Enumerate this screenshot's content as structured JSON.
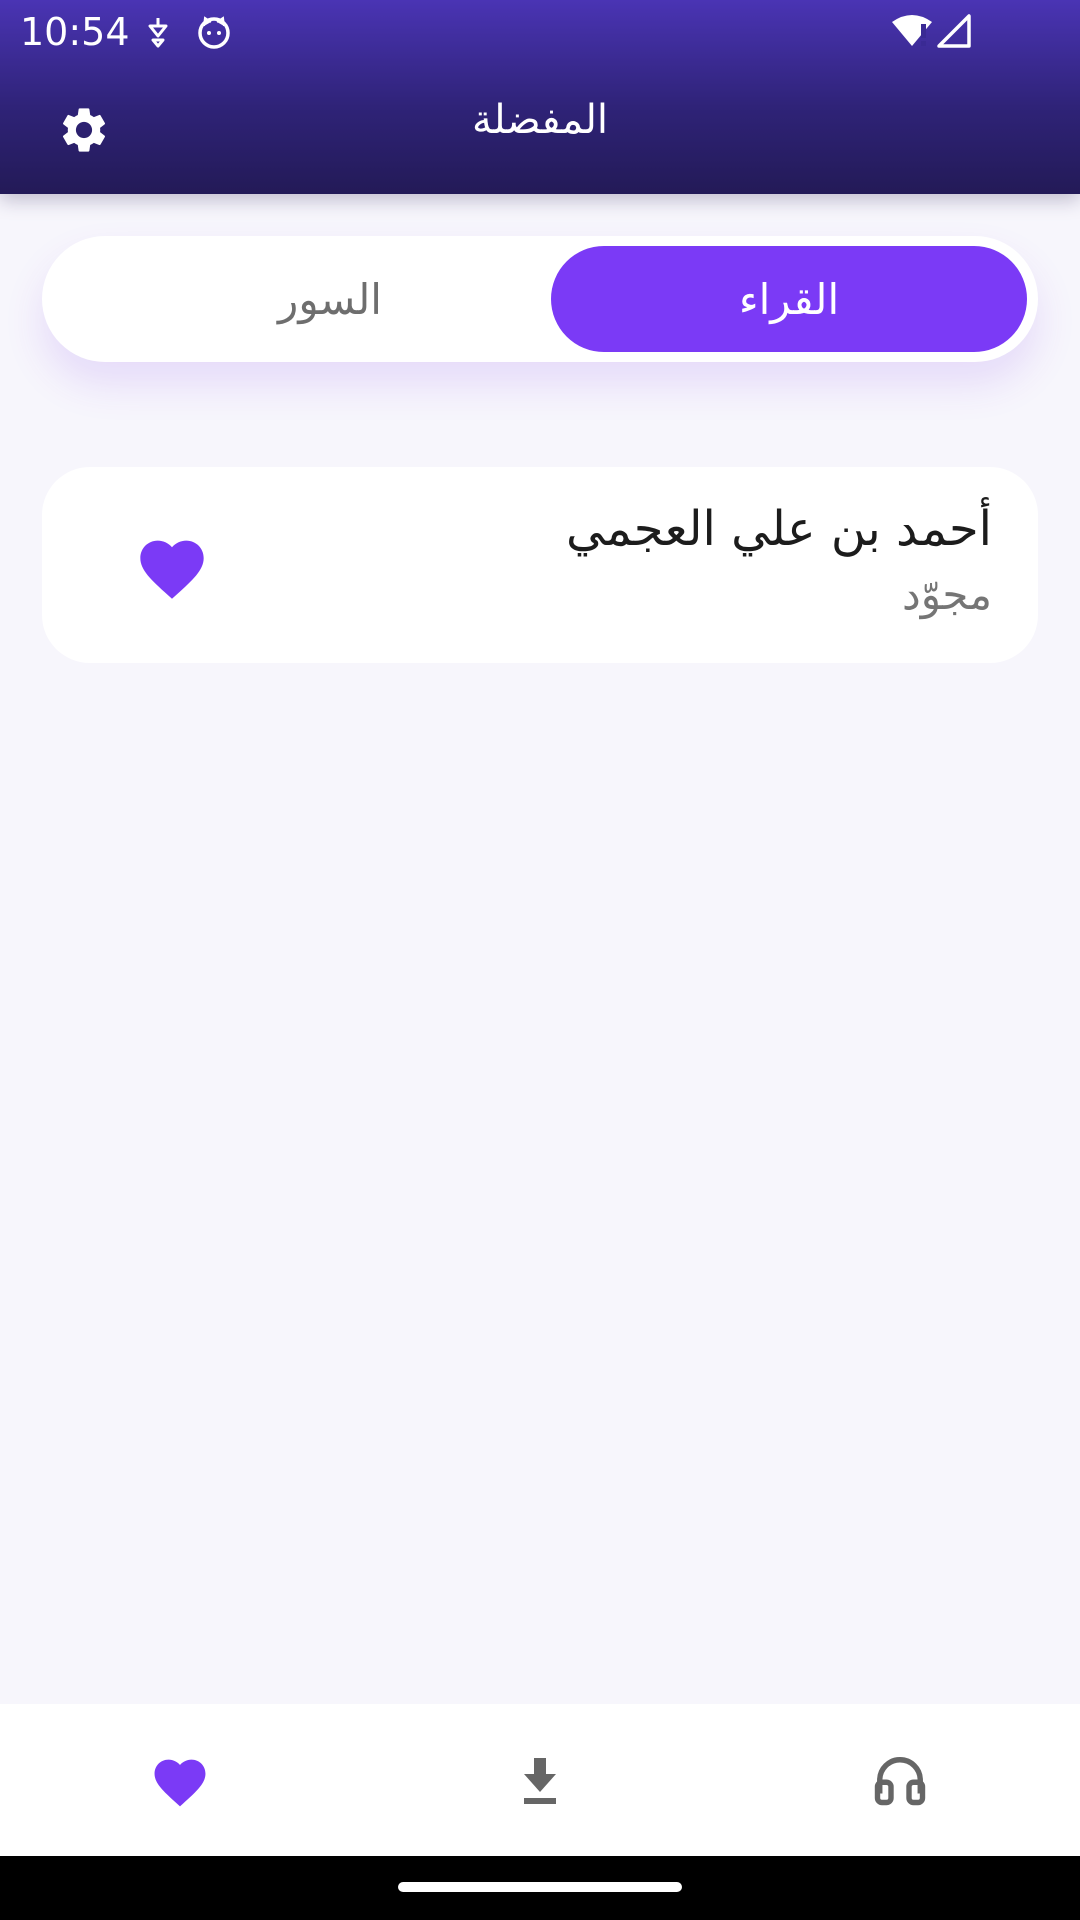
{
  "status_bar": {
    "time": "10:54",
    "icons": [
      "notification-icon",
      "cat-face-icon",
      "wifi-alert-icon",
      "cellular-signal-icon"
    ]
  },
  "header": {
    "title": "المفضلة",
    "settings_icon": "gear-icon"
  },
  "tabs": [
    {
      "label": "القراء",
      "selected": true
    },
    {
      "label": "السور",
      "selected": false
    }
  ],
  "favorites": [
    {
      "name": "أحمد بن علي العجمي",
      "style": "مجوّد",
      "icon": "heart-icon"
    }
  ],
  "bottom_nav": [
    {
      "icon": "heart-icon",
      "selected": true
    },
    {
      "icon": "download-icon",
      "selected": false
    },
    {
      "icon": "headphones-icon",
      "selected": false
    }
  ],
  "colors": {
    "accent": "#7b3af6",
    "header_top": "#4a34b4",
    "header_bottom": "#231a57",
    "background": "#f7f6fc"
  }
}
